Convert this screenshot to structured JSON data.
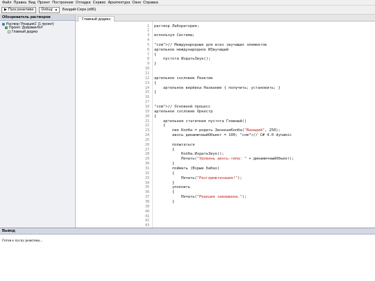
{
  "menu": [
    "Файл",
    "Правка",
    "Вид",
    "Проект",
    "Построение",
    "Отладка",
    "Сервис",
    "Архитектура",
    "Окно",
    "Справка"
  ],
  "toolbar": {
    "run_label": "Пуск реактива",
    "config": "Debug",
    "platform_label": "Бандай-Сера (x86)"
  },
  "sidebar": {
    "title": "Обозреватель растворов",
    "items": [
      {
        "label": "Раствор 'Реакция1' (1 проект)"
      },
      {
        "label": "Проект 'Дофамин%#'"
      },
      {
        "label": "Главный додикз"
      }
    ]
  },
  "tab": {
    "label": "Главный додикз"
  },
  "editor": {
    "line_numbers": [
      "1",
      "2",
      "3",
      "4",
      "5",
      "6",
      "7",
      "8",
      "9",
      "10",
      "11",
      "12",
      "13",
      "14",
      "15",
      "16",
      "17",
      "18",
      "19",
      "20",
      "21",
      "22",
      "23",
      "24",
      "25",
      "26",
      "27",
      "28",
      "29",
      "30",
      "31",
      "32",
      "33",
      "34",
      "35",
      "36",
      "37",
      "38",
      "39",
      "40",
      "41",
      "42",
      "43"
    ],
    "lines": [
      [
        {
          "t": "раствор Лаборатория;"
        }
      ],
      [],
      [
        {
          "t": "используя Система;"
        }
      ],
      [],
      [
        {
          "t": "\"com\">// Международные для всех звучащих элементов"
        }
      ],
      [
        {
          "t": "артельное международное ИЗвучащий"
        }
      ],
      [
        {
          "t": "{"
        }
      ],
      [
        {
          "t": "    пустота ИздатьЗвук();"
        }
      ],
      [
        {
          "t": "}"
        }
      ],
      [],
      [],
      [
        {
          "t": "артельное сословие Реактив"
        }
      ],
      [
        {
          "t": "{"
        }
      ],
      [
        {
          "t": "    артельное верёвка Название { получить; установить; }"
        }
      ],
      [
        {
          "t": "}"
        }
      ],
      [],
      [],
      [
        {
          "t": "\"com\">// Основной процесс"
        }
      ],
      [
        {
          "t": "артельное сословие Оркестр"
        }
      ],
      [
        {
          "t": "{"
        }
      ],
      [
        {
          "t": "    артельная статичная пустота Главный()"
        }
      ],
      [
        {
          "t": "    {"
        }
      ],
      [
        {
          "t": "        пик Колба = родить ЗвонкаяКолба("
        },
        {
          "t": "\"Ванадий\"",
          "s": 1
        },
        {
          "t": ", 250);"
        }
      ],
      [
        {
          "t": "        авось динамичныйОбъект = 100; \"com\">// C# 4.0 dynamic"
        }
      ],
      [],
      [
        {
          "t": "        попытаться"
        }
      ],
      [
        {
          "t": "        {"
        }
      ],
      [
        {
          "t": "            Колба.ИздатьЗвук();"
        }
      ],
      [
        {
          "t": "            Печать("
        },
        {
          "t": "\"Уровень авось-типа: \"",
          "s": 1
        },
        {
          "t": " + динамичныйОбъект);"
        }
      ],
      [
        {
          "t": "        }"
        }
      ],
      [
        {
          "t": "        поймать (Взрыв бабах)"
        }
      ],
      [
        {
          "t": "        {"
        }
      ],
      [
        {
          "t": "            Печать("
        },
        {
          "t": "\"Разгерметизация!\"",
          "s": 1
        },
        {
          "t": ");"
        }
      ],
      [
        {
          "t": "        }"
        }
      ],
      [
        {
          "t": "        упокоить"
        }
      ],
      [
        {
          "t": "        {"
        }
      ],
      [
        {
          "t": "            Печать("
        },
        {
          "t": "\"Реакция завершена.\"",
          "s": 1
        },
        {
          "t": ");"
        }
      ],
      [
        {
          "t": "        }"
        }
      ]
    ]
  },
  "output": {
    "title": "Вывод",
    "text": "Готов к пуску реактива..."
  },
  "colors": {
    "string": "#b8221c",
    "panel_header": "#d3d8e2",
    "gutter_text": "#7a7a7a"
  }
}
